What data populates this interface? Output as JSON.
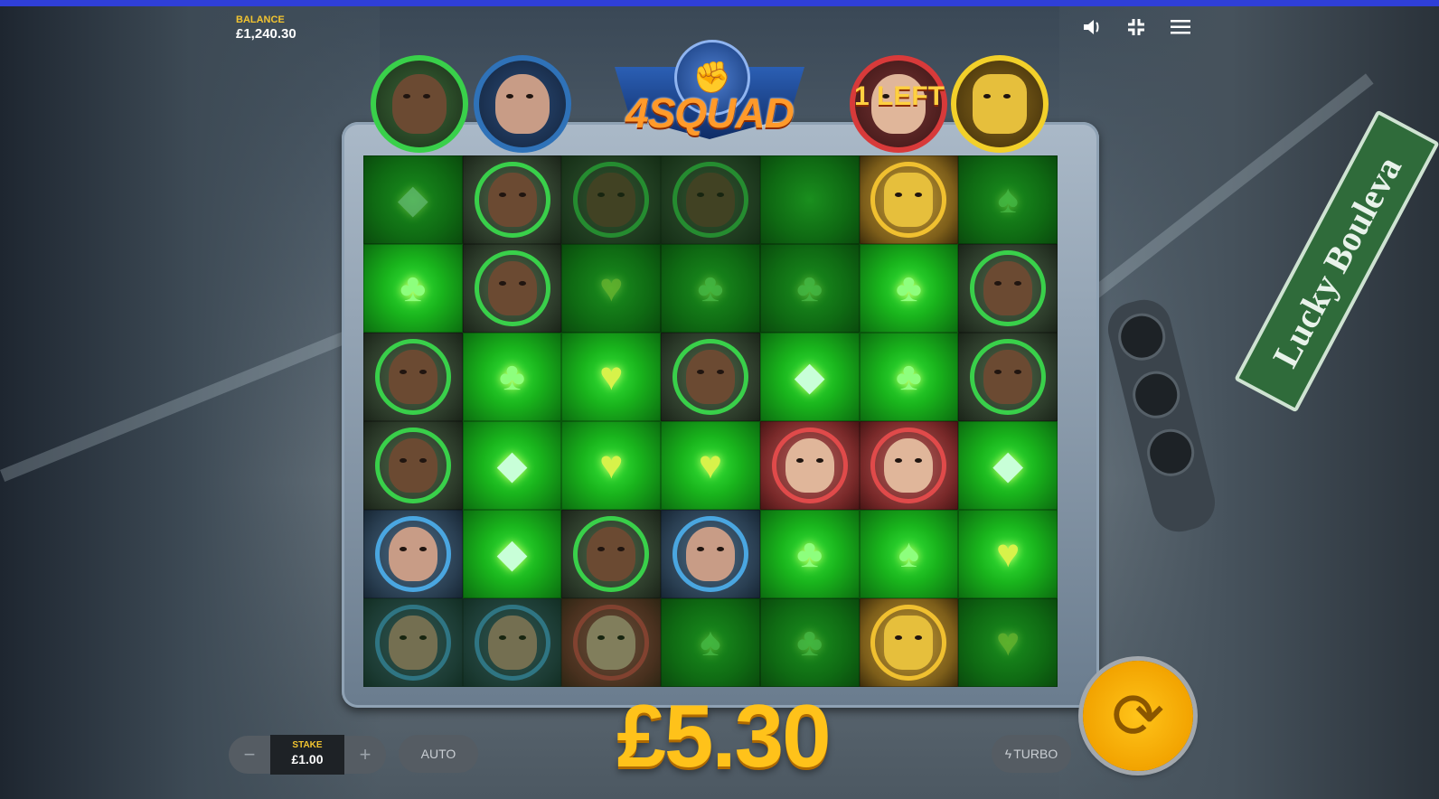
{
  "balance": {
    "label": "BALANCE",
    "value": "£1,240.30"
  },
  "hud": {
    "sound_icon": "speaker-icon",
    "fullscreen_icon": "exit-fullscreen-icon",
    "menu_icon": "hamburger-menu-icon"
  },
  "banner": {
    "title": "4SQUAD",
    "fist_icon": "fist-icon"
  },
  "collect_status": {
    "text": "1 LEFT"
  },
  "street_sign": {
    "text": "Lucky Boulevа"
  },
  "grid": {
    "rows": [
      [
        "diamond-dim",
        "green-hero",
        "green-hero-dim",
        "green-hero-dim",
        "green-dim",
        "gold-fist",
        "spade-dim"
      ],
      [
        "club",
        "green-hero",
        "heart-dim",
        "club-dim",
        "club-dim",
        "club",
        "green-hero"
      ],
      [
        "green-hero",
        "club",
        "heart",
        "green-hero",
        "diamond",
        "club",
        "green-hero"
      ],
      [
        "green-hero",
        "diamond",
        "heart",
        "heart",
        "red-hero",
        "red-hero",
        "diamond"
      ],
      [
        "blue-hero",
        "diamond",
        "green-hero",
        "blue-hero",
        "club",
        "spade",
        "heart"
      ],
      [
        "blue-hero-dim",
        "blue-hero-dim",
        "red-hero-dim",
        "spade-dim",
        "club-dim",
        "gold-fist",
        "heart-dim"
      ]
    ]
  },
  "controls": {
    "minus_label": "−",
    "plus_label": "+",
    "stake_label": "STAKE",
    "stake_value": "£1.00",
    "auto_label": "AUTO",
    "turbo_label": "TURBO"
  },
  "win_amount": "£5.30",
  "colors": {
    "accent": "#2f3fd8",
    "gold": "#ffc21a",
    "green": "#1fc423"
  }
}
